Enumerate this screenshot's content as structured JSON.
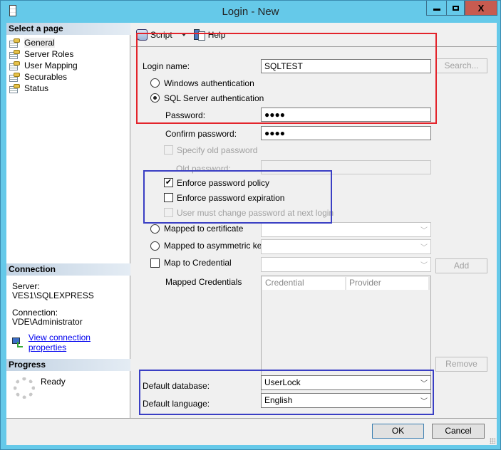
{
  "window": {
    "title": "Login - New",
    "controls": {
      "minimize": "minimize",
      "maximize": "maximize",
      "close": "X"
    }
  },
  "sidebar": {
    "select_page_heading": "Select a page",
    "pages": [
      {
        "label": "General",
        "selected": true
      },
      {
        "label": "Server Roles"
      },
      {
        "label": "User Mapping"
      },
      {
        "label": "Securables"
      },
      {
        "label": "Status"
      }
    ],
    "connection": {
      "heading": "Connection",
      "server_label": "Server:",
      "server_value": "VES1\\SQLEXPRESS",
      "connection_label": "Connection:",
      "connection_value": "VDE\\Administrator",
      "link": "View connection properties"
    },
    "progress": {
      "heading": "Progress",
      "status": "Ready"
    }
  },
  "toolbar": {
    "script_label": "Script",
    "help_label": "Help"
  },
  "form": {
    "login_name_label": "Login name:",
    "login_name_value": "SQLTEST",
    "search_button": "Search...",
    "windows_auth_label": "Windows authentication",
    "sql_auth_label": "SQL Server authentication",
    "auth_selected": "sql",
    "password_label": "Password:",
    "password_value": "●●●●",
    "confirm_password_label": "Confirm password:",
    "confirm_password_value": "●●●●",
    "specify_old_password_label": "Specify old password",
    "old_password_label": "Old password:",
    "enforce_policy_label": "Enforce password policy",
    "enforce_policy_checked": true,
    "enforce_expiration_label": "Enforce password expiration",
    "enforce_expiration_checked": false,
    "must_change_label": "User must change password at next login",
    "mapped_cert_label": "Mapped to certificate",
    "mapped_asym_label": "Mapped to asymmetric key",
    "map_credential_label": "Map to Credential",
    "add_button": "Add",
    "mapped_credentials_label": "Mapped Credentials",
    "grid_columns": [
      "Credential",
      "Provider"
    ],
    "remove_button": "Remove",
    "default_database_label": "Default database:",
    "default_database_value": "UserLock",
    "default_language_label": "Default language:",
    "default_language_value": "English"
  },
  "footer": {
    "ok_button": "OK",
    "cancel_button": "Cancel"
  },
  "colors": {
    "titlebar": "#65c9e9",
    "close_button": "#c75b50",
    "highlight_red": "#e3242b",
    "highlight_blue": "#3a3fc4"
  }
}
